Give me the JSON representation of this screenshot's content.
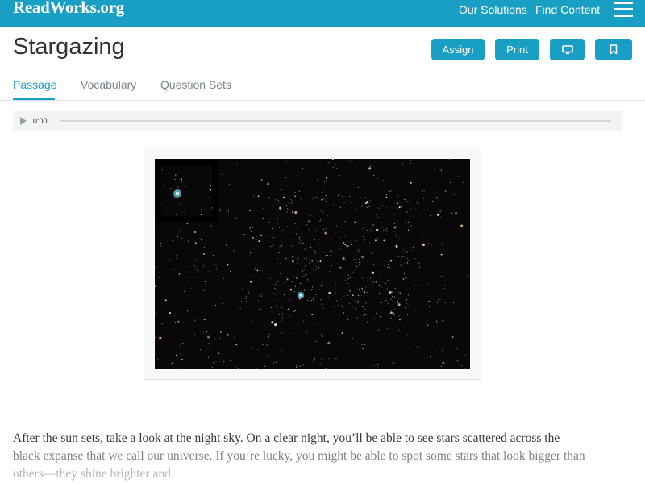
{
  "header": {
    "logo": "ReadWorks.org",
    "nav": [
      "Our Solutions",
      "Find Content"
    ],
    "menu_icon": "hamburger-icon"
  },
  "page": {
    "title": "Stargazing",
    "buttons": {
      "assign": "Assign",
      "print": "Print",
      "present_icon": "monitor-icon",
      "bookmark_icon": "bookmark-icon"
    }
  },
  "tabs": [
    "Passage",
    "Vocabulary",
    "Question Sets"
  ],
  "audio": {
    "time": "0:00",
    "play_icon": "play-icon"
  },
  "passage": {
    "lines": [
      "After the sun sets, take a look at the night sky. On a clear night, you’ll be able to see stars scattered across the",
      "black expanse that we call our universe. If you’re lucky, you might be able to spot some stars that look bigger than",
      "others—they shine brighter and"
    ]
  },
  "colors": {
    "accent": "#1a9fc4",
    "sky": "#0a0708",
    "text": "#333a3d"
  }
}
